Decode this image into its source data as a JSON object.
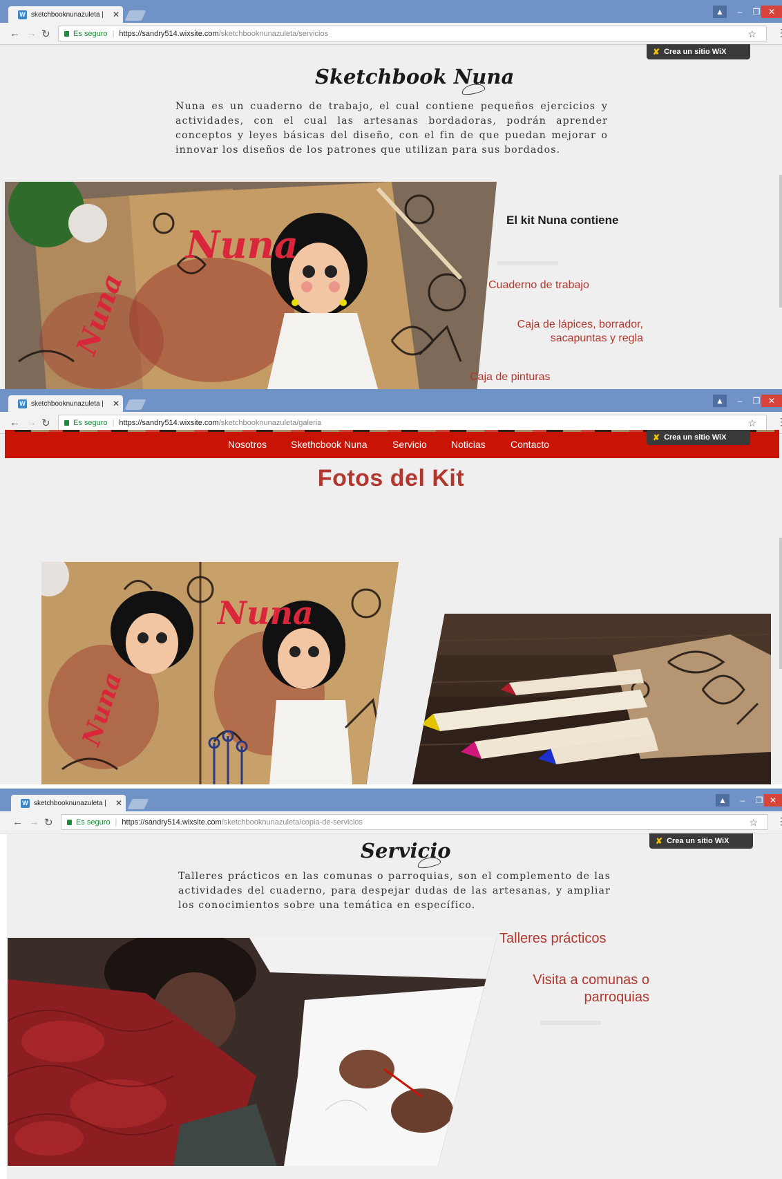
{
  "screens": [
    {
      "tab_title": "sketchbooknunazuleta | ",
      "secure_label": "Es seguro",
      "url_host": "https://sandry514.wixsite.com",
      "url_path": "/sketchbooknunazuleta/servicios",
      "wix_badge": "Crea un sitio WiX",
      "logo": "Sketchbook Nuna",
      "intro": "Nuna es un cuaderno de trabajo, el cual contiene pequeños ejercicios y actividades, con el cual las artesanas bordadoras, podrán aprender conceptos y leyes básicas del diseño, con el fin de que puedan mejorar o innovar los diseños de los patrones que utilizan para sus bordados.",
      "image_text": [
        "Nuna",
        "Nuna"
      ],
      "kit_title": "El kit Nuna contiene",
      "kit_items": [
        "Cuaderno de trabajo",
        "Caja de lápices, borrador,",
        "sacapuntas y regla",
        "Caja de pinturas"
      ]
    },
    {
      "tab_title": "sketchbooknunazuleta | ",
      "secure_label": "Es seguro",
      "url_host": "https://sandry514.wixsite.com",
      "url_path": "/sketchbooknunazuleta/galeria",
      "wix_badge": "Crea un sitio WiX",
      "nav": [
        "Nosotros",
        "Skethcbook Nuna",
        "Servicio",
        "Noticias",
        "Contacto"
      ],
      "gallery_title": "Fotos del Kit",
      "image_text": [
        "Nuna",
        "Nuna"
      ]
    },
    {
      "tab_title": "sketchbooknunazuleta | ",
      "secure_label": "Es seguro",
      "url_host": "https://sandry514.wixsite.com",
      "url_path": "/sketchbooknunazuleta/copia-de-servicios",
      "wix_badge": "Crea un sitio WiX",
      "logo": "Servicio",
      "intro": "Talleres prácticos en las comunas o parroquias, son el complemento de las actividades del cuaderno, para despejar dudas de las artesanas, y ampliar los conocimientos sobre una temática en específico.",
      "service_items": [
        "Talleres prácticos",
        "Visita a comunas o",
        "parroquias"
      ]
    }
  ],
  "colors": {
    "accent_red": "#b2372f",
    "nav_red": "#c91405",
    "tab_bar": "#6f93c6",
    "secure_green": "#1e8a3c"
  },
  "icons": {
    "back": "arrow-left-icon",
    "forward": "arrow-right-icon",
    "reload": "reload-icon",
    "lock": "lock-icon",
    "star": "star-icon",
    "menu": "kebab-menu-icon",
    "close": "close-icon"
  }
}
